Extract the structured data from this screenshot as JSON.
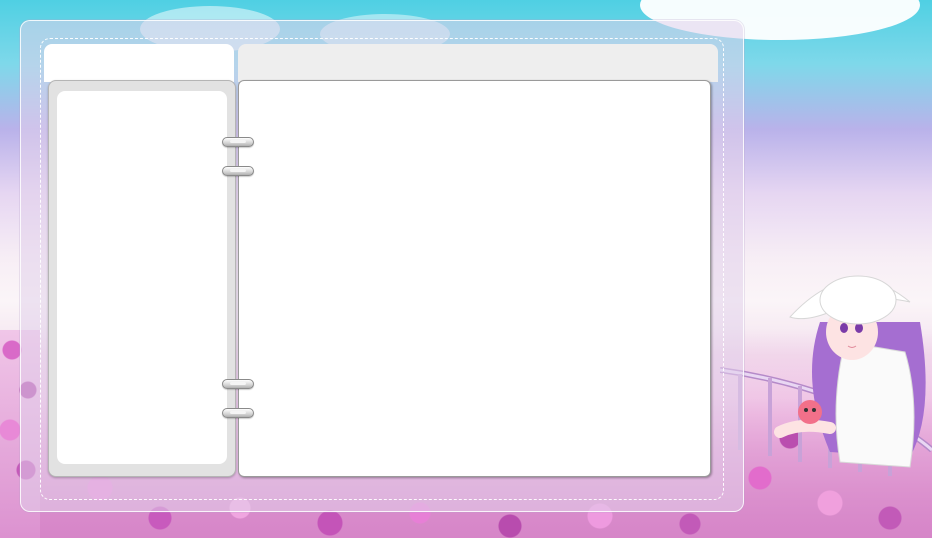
{
  "page": {
    "left_tab_label": "",
    "right_header_label": ""
  },
  "theme": {
    "sky": "#4fd0e3",
    "lavender": "#b9b2ea",
    "flower_pink": "#e06acb",
    "flower_magenta": "#b94ab0",
    "panel_white": "#ffffff",
    "panel_gray": "#e2e2e2",
    "header_gray": "#eeeeee"
  },
  "decorations": {
    "binder_rings": 4,
    "illustration": "girl-in-white-hat-leaning-on-railing-icon"
  }
}
